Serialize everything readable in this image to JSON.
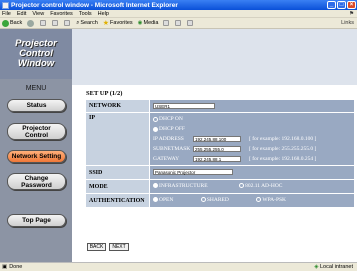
{
  "window": {
    "title": "Projector control window - Microsoft Internet Explorer"
  },
  "menubar": [
    "File",
    "Edit",
    "View",
    "Favorites",
    "Tools",
    "Help"
  ],
  "toolbar": {
    "back": "Back",
    "search": "Search",
    "favorites": "Favorites",
    "media": "Media",
    "links": "Links"
  },
  "sidebar": {
    "logo": [
      "Projector",
      "Control",
      "Window"
    ],
    "menu_label": "MENU",
    "items": [
      {
        "label": "Status"
      },
      {
        "label_lines": [
          "Projector",
          "Control"
        ]
      },
      {
        "label": "Network Setting",
        "active": true
      },
      {
        "label_lines": [
          "Change",
          "Password"
        ]
      },
      {
        "label": "Top Page"
      }
    ]
  },
  "main": {
    "title": "SET UP (1/2)",
    "rows": {
      "network": {
        "label": "NETWORK",
        "value": "USER1"
      },
      "ip": {
        "label": "IP",
        "dhcp_on": "DHCP ON",
        "dhcp_off": "DHCP OFF",
        "selected": "DHCP OFF",
        "fields": [
          {
            "label": "IP ADDRESS",
            "value": "192.245.88.100",
            "example": "[ for example: 192.168.0.100 ]"
          },
          {
            "label": "SUBNETMASK",
            "value": "255.255.255.0",
            "example": "[ for example: 255.255.255.0 ]"
          },
          {
            "label": "GATEWAY",
            "value": "192.245.88.1",
            "example": "[ for example: 192.168.0.254 ]"
          }
        ]
      },
      "ssid": {
        "label": "SSID",
        "value": "Panasonic Projector"
      },
      "mode": {
        "label": "MODE",
        "options": [
          "INFRASTRUCTURE",
          "802.11 AD-HOC"
        ],
        "selected": "INFRASTRUCTURE"
      },
      "authentication": {
        "label": "AUTHENTICATION",
        "options": [
          "OPEN",
          "SHARED",
          "WPA-PSK"
        ],
        "selected": "OPEN"
      }
    },
    "buttons": {
      "back": "BACK",
      "next": "NEXT"
    }
  },
  "statusbar": {
    "left": "Done",
    "right": "Local intranet"
  }
}
